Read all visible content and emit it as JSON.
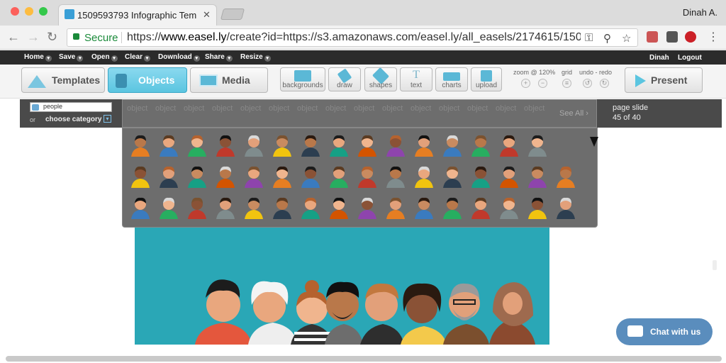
{
  "browser": {
    "tab_title": "1509593793 Infographic Tem",
    "tab_close": "✕",
    "profile": "Dinah A.",
    "secure_label": "Secure",
    "url_prefix": "https://",
    "url_host": "www.easel.ly",
    "url_rest": "/create?id=https://s3.amazonaws.com/easel.ly/all_easels/2174615/150959...",
    "icons": [
      "back-icon",
      "forward-icon",
      "reload-icon",
      "lock-icon",
      "key-icon",
      "zoom-icon",
      "star-icon",
      "extension-icon",
      "pinterest-icon",
      "menu-icon"
    ]
  },
  "menu": {
    "items": [
      "Home",
      "Save",
      "Open",
      "Clear",
      "Download",
      "Share",
      "Resize"
    ],
    "user": "Dinah",
    "logout": "Logout"
  },
  "toolbar": {
    "templates": "Templates",
    "objects": "Objects",
    "media": "Media",
    "tools": [
      "backgrounds",
      "draw",
      "shapes",
      "text",
      "charts",
      "upload"
    ],
    "zoom": "zoom @ 120%",
    "grid": "grid",
    "undo_redo": "undo - redo",
    "present": "Present"
  },
  "search": {
    "value": "people",
    "or": "or",
    "category": "choose category"
  },
  "objects": {
    "word": "object",
    "see_all": "See All ›"
  },
  "page": {
    "label": "page slide",
    "counter": "45 of 40"
  },
  "chat": {
    "label": "Chat with us"
  },
  "colors": {
    "accent": "#5bc5e0",
    "panel": "#6d6d6d",
    "canvas": "#2aa7b6",
    "chat": "#5a8dbd"
  }
}
